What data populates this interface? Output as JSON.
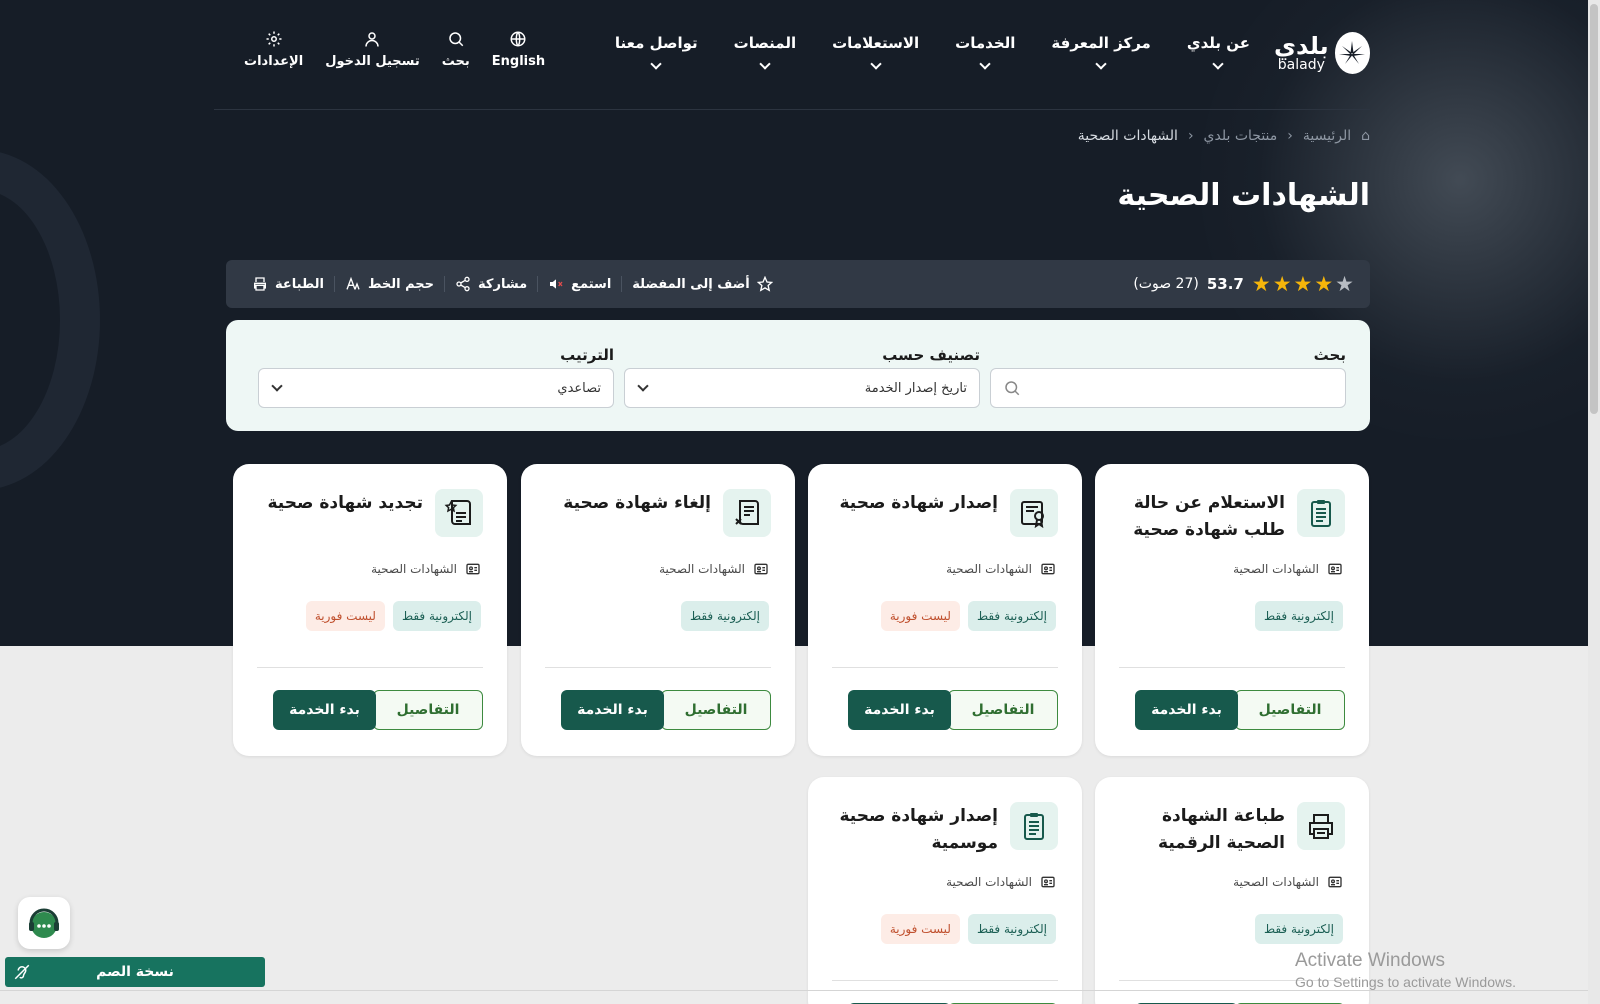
{
  "logo": {
    "arabic": "بلدي",
    "latin": "balady"
  },
  "nav": [
    {
      "label": "عن بلدي"
    },
    {
      "label": "مركز المعرفة"
    },
    {
      "label": "الخدمات"
    },
    {
      "label": "الاستعلامات"
    },
    {
      "label": "المنصات"
    },
    {
      "label": "تواصل معنا"
    }
  ],
  "tools": {
    "language": "English",
    "search": "بحث",
    "login": "تسجيل الدخول",
    "settings": "الإعدادات"
  },
  "breadcrumb": {
    "home": "الرئيسية",
    "products": "منتجات بلدي",
    "current": "الشهادات الصحية"
  },
  "page_title": "الشهادات الصحية",
  "rating": {
    "stars_filled": 4,
    "stars_total": 5,
    "score": "53.7",
    "votes": "(27 صوت)"
  },
  "actions": {
    "favorite": "أضف إلى المفضلة",
    "listen": "استمع",
    "share": "مشاركة",
    "font_size": "حجم الخط",
    "print": "الطباعة"
  },
  "filters": {
    "search_label": "بحث",
    "search_value": "",
    "classify_label": "تصنيف حسب",
    "classify_value": "تاريخ إصدار الخدمة",
    "sort_label": "الترتيب",
    "sort_value": "تصاعدي"
  },
  "card_buttons": {
    "details": "التفاصيل",
    "start": "بدء الخدمة"
  },
  "cards": [
    {
      "title": "الاستعلام عن حالة طلب شهادة صحية",
      "category": "الشهادات الصحية",
      "tag_electronic": "إلكترونية فقط",
      "tag_instant": "",
      "icon": "clipboard-icon"
    },
    {
      "title": "إصدار شهادة صحية",
      "category": "الشهادات الصحية",
      "tag_electronic": "إلكترونية فقط",
      "tag_instant": "ليست فورية",
      "icon": "certificate-icon"
    },
    {
      "title": "إلغاء شهادة صحية",
      "category": "الشهادات الصحية",
      "tag_electronic": "إلكترونية فقط",
      "tag_instant": "",
      "icon": "scroll-cancel-icon"
    },
    {
      "title": "تجديد شهادة صحية",
      "category": "الشهادات الصحية",
      "tag_electronic": "إلكترونية فقط",
      "tag_instant": "ليست فورية",
      "icon": "scroll-star-icon"
    },
    {
      "title": "طباعة الشهادة الصحية الرقمية",
      "category": "الشهادات الصحية",
      "tag_electronic": "إلكترونية فقط",
      "tag_instant": "",
      "icon": "printer-icon"
    },
    {
      "title": "إصدار شهادة صحية موسمية",
      "category": "الشهادات الصحية",
      "tag_electronic": "إلكترونية فقط",
      "tag_instant": "ليست فورية",
      "icon": "clipboard-icon"
    }
  ],
  "deaf_version": "نسخة الصم",
  "windows_notice": {
    "line1": "Activate Windows",
    "line2": "Go to Settings to activate Windows."
  },
  "colors": {
    "hero_bg": "#161d27",
    "primary": "#17594c",
    "star": "#f5b50a",
    "accent_green": "#3d8a3f"
  }
}
